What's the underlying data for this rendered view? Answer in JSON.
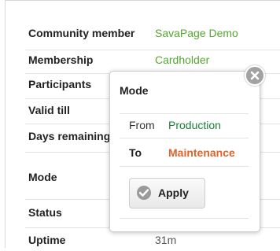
{
  "rows": [
    {
      "label": "Community member",
      "value": "SavaPage Demo"
    },
    {
      "label": "Membership",
      "value": "Cardholder"
    },
    {
      "label": "Participants",
      "value": ""
    },
    {
      "label": "Valid till",
      "value": ""
    },
    {
      "label": "Days remaining",
      "value": ""
    },
    {
      "label": "Mode",
      "value": ""
    },
    {
      "label": "Status",
      "value": ""
    },
    {
      "label": "Uptime",
      "value": "31m"
    }
  ],
  "popup": {
    "title": "Mode",
    "from_label": "From",
    "from_value": "Production",
    "to_label": "To",
    "to_value": "Maintenance",
    "apply_label": "Apply",
    "close_icon": "close-icon",
    "apply_icon": "check-icon"
  },
  "colors": {
    "green": "#55a630",
    "production": "#1a7f37",
    "maintenance": "#e0632a"
  }
}
